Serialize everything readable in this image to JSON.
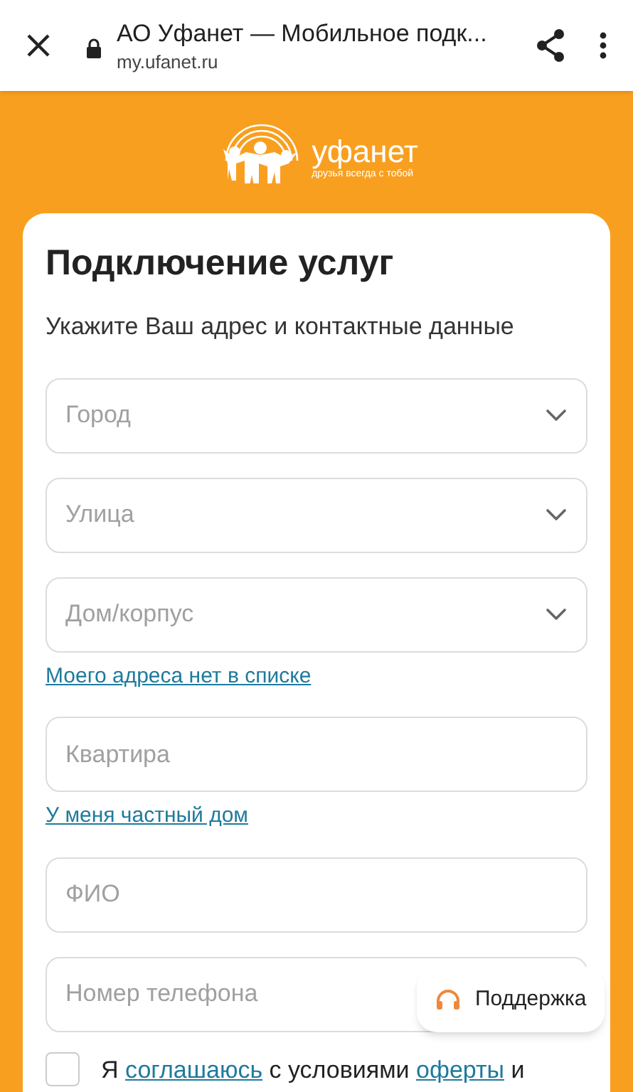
{
  "browser_bar": {
    "title": "АО Уфанет — Мобильное подк...",
    "url": "my.ufanet.ru"
  },
  "logo": {
    "name": "уфанет",
    "tagline": "друзья всегда с тобой"
  },
  "form": {
    "title": "Подключение услуг",
    "subtitle": "Укажите Ваш адрес и контактные данные",
    "items": [
      {
        "kind": "select",
        "placeholder": "Город"
      },
      {
        "kind": "select",
        "placeholder": "Улица"
      },
      {
        "kind": "select",
        "placeholder": "Дом/корпус"
      },
      {
        "kind": "link",
        "text": "Моего адреса нет в списке"
      },
      {
        "kind": "input",
        "placeholder": "Квартира"
      },
      {
        "kind": "link",
        "text": "У меня частный дом"
      },
      {
        "kind": "input",
        "placeholder": "ФИО"
      },
      {
        "kind": "input",
        "placeholder": "Номер телефона"
      }
    ],
    "consent": {
      "checked": false,
      "parts": [
        {
          "text": "Я ",
          "link": false
        },
        {
          "text": "соглашаюсь",
          "link": true
        },
        {
          "text": " с условиями ",
          "link": false
        },
        {
          "text": "оферты",
          "link": true
        },
        {
          "text": " и",
          "link": false
        }
      ]
    }
  },
  "support_button": {
    "label": "Поддержка"
  }
}
